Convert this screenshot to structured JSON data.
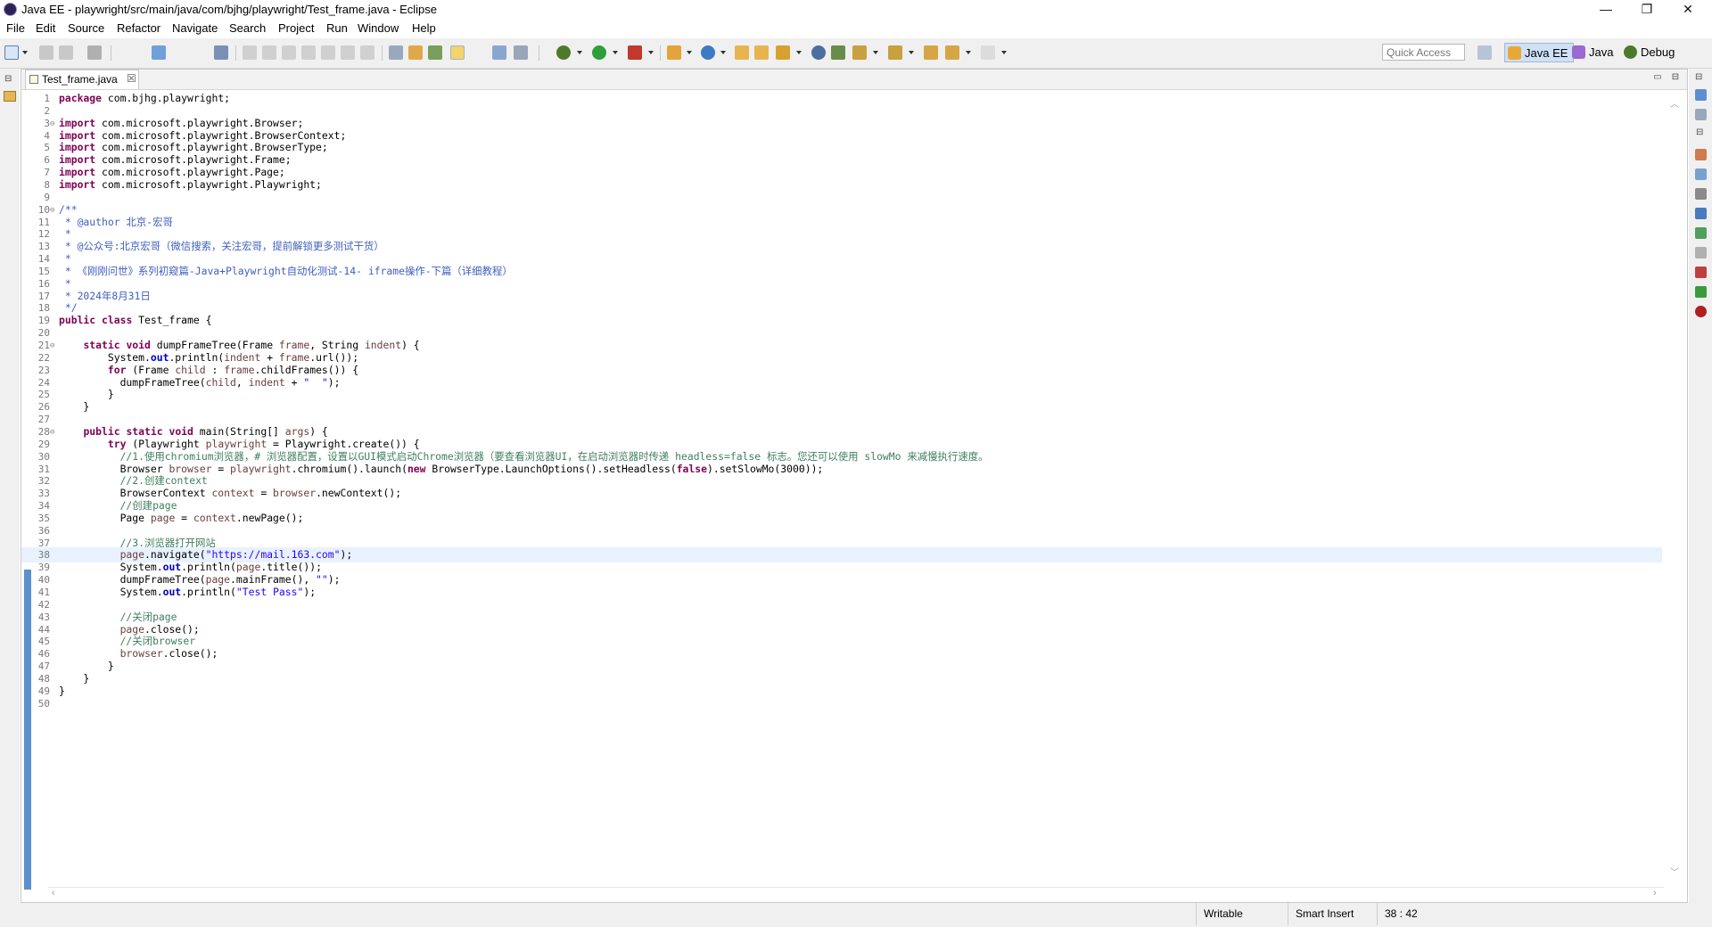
{
  "window": {
    "title": "Java EE - playwright/src/main/java/com/bjhg/playwright/Test_frame.java - Eclipse",
    "minimize_glyph": "—",
    "restore_glyph": "❐",
    "close_glyph": "✕"
  },
  "menu": [
    "File",
    "Edit",
    "Source",
    "Refactor",
    "Navigate",
    "Search",
    "Project",
    "Run",
    "Window",
    "Help"
  ],
  "toolbar": {
    "quick_access_placeholder": "Quick Access",
    "perspectives": [
      "Java EE",
      "Java",
      "Debug"
    ],
    "colors": {
      "java_ee_bg": "#cfe0f7",
      "run": "#2e9e3a",
      "debug": "#4d7a2a"
    }
  },
  "editor": {
    "tab_label": "Test_frame.java",
    "tab_close": "☒",
    "current_line": 38,
    "lines": [
      {
        "n": "1",
        "t": "package com.bjhg.playwright;"
      },
      {
        "n": "2",
        "t": ""
      },
      {
        "n": "3",
        "t": "import com.microsoft.playwright.Browser;",
        "fold": "⊖"
      },
      {
        "n": "4",
        "t": "import com.microsoft.playwright.BrowserContext;"
      },
      {
        "n": "5",
        "t": "import com.microsoft.playwright.BrowserType;"
      },
      {
        "n": "6",
        "t": "import com.microsoft.playwright.Frame;"
      },
      {
        "n": "7",
        "t": "import com.microsoft.playwright.Page;"
      },
      {
        "n": "8",
        "t": "import com.microsoft.playwright.Playwright;"
      },
      {
        "n": "9",
        "t": ""
      },
      {
        "n": "10",
        "t": "/**",
        "fold": "⊖"
      },
      {
        "n": "11",
        "t": " * @author 北京-宏哥"
      },
      {
        "n": "12",
        "t": " *"
      },
      {
        "n": "13",
        "t": " * @公众号:北京宏哥（微信搜索，关注宏哥，提前解锁更多测试干货）"
      },
      {
        "n": "14",
        "t": " *"
      },
      {
        "n": "15",
        "t": " * 《刚刚问世》系列初窥篇-Java+Playwright自动化测试-14- iframe操作-下篇（详细教程）"
      },
      {
        "n": "16",
        "t": " *"
      },
      {
        "n": "17",
        "t": " * 2024年8月31日"
      },
      {
        "n": "18",
        "t": " */"
      },
      {
        "n": "19",
        "t": "public class Test_frame {"
      },
      {
        "n": "20",
        "t": ""
      },
      {
        "n": "21",
        "t": "    static void dumpFrameTree(Frame frame, String indent) {",
        "fold": "⊖"
      },
      {
        "n": "22",
        "t": "        System.out.println(indent + frame.url());"
      },
      {
        "n": "23",
        "t": "        for (Frame child : frame.childFrames()) {"
      },
      {
        "n": "24",
        "t": "          dumpFrameTree(child, indent + \"  \");"
      },
      {
        "n": "25",
        "t": "        }"
      },
      {
        "n": "26",
        "t": "    }"
      },
      {
        "n": "27",
        "t": ""
      },
      {
        "n": "28",
        "t": "    public static void main(String[] args) {",
        "fold": "⊖"
      },
      {
        "n": "29",
        "t": "        try (Playwright playwright = Playwright.create()) {"
      },
      {
        "n": "30",
        "t": "          //1.使用chromium浏览器，# 浏览器配置，设置以GUI模式启动Chrome浏览器（要查看浏览器UI，在启动浏览器时传递 headless=false 标志。您还可以使用 slowMo 来减慢执行速度。"
      },
      {
        "n": "31",
        "t": "          Browser browser = playwright.chromium().launch(new BrowserType.LaunchOptions().setHeadless(false).setSlowMo(3000));"
      },
      {
        "n": "32",
        "t": "          //2.创建context"
      },
      {
        "n": "33",
        "t": "          BrowserContext context = browser.newContext();"
      },
      {
        "n": "34",
        "t": "          //创建page"
      },
      {
        "n": "35",
        "t": "          Page page = context.newPage();"
      },
      {
        "n": "36",
        "t": ""
      },
      {
        "n": "37",
        "t": "          //3.浏览器打开网站"
      },
      {
        "n": "38",
        "t": "          page.navigate(\"https://mail.163.com\");"
      },
      {
        "n": "39",
        "t": "          System.out.println(page.title());"
      },
      {
        "n": "40",
        "t": "          dumpFrameTree(page.mainFrame(), \"\");"
      },
      {
        "n": "41",
        "t": "          System.out.println(\"Test Pass\");"
      },
      {
        "n": "42",
        "t": ""
      },
      {
        "n": "43",
        "t": "          //关闭page"
      },
      {
        "n": "44",
        "t": "          page.close();"
      },
      {
        "n": "45",
        "t": "          //关闭browser"
      },
      {
        "n": "46",
        "t": "          browser.close();"
      },
      {
        "n": "47",
        "t": "        }"
      },
      {
        "n": "48",
        "t": "    }"
      },
      {
        "n": "49",
        "t": "}"
      },
      {
        "n": "50",
        "t": ""
      }
    ]
  },
  "status": {
    "writable": "Writable",
    "insert_mode": "Smart Insert",
    "position": "38 : 42"
  }
}
